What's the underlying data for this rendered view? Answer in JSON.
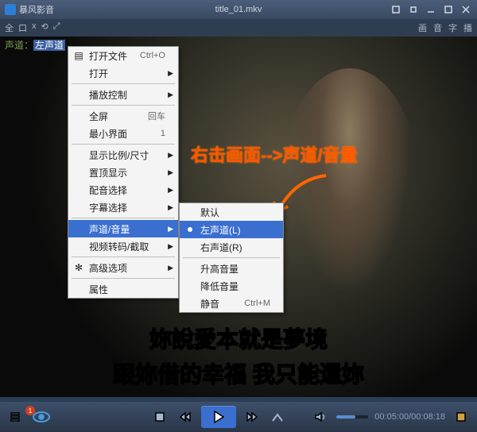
{
  "titlebar": {
    "app_name": "暴风影音",
    "file_title": "title_01.mkv"
  },
  "toolbar": {
    "left": [
      "全",
      "口",
      "x",
      "⟲",
      "⤢"
    ],
    "right": [
      "画",
      "音",
      "字",
      "播"
    ]
  },
  "channel_overlay": {
    "prefix": "声道：",
    "value": "左声道"
  },
  "annotation": "右击画面-->声道/音量",
  "context_menu": {
    "items": [
      {
        "label": "打开文件",
        "shortcut": "Ctrl+O",
        "icon": "open"
      },
      {
        "label": "打开",
        "shortcut": "",
        "sub": true
      },
      {
        "sep": true
      },
      {
        "label": "播放控制",
        "shortcut": "",
        "sub": true
      },
      {
        "sep": true
      },
      {
        "label": "全屏",
        "shortcut": "回车"
      },
      {
        "label": "最小界面",
        "shortcut": "1"
      },
      {
        "sep": true
      },
      {
        "label": "显示比例/尺寸",
        "shortcut": "",
        "sub": true
      },
      {
        "label": "置顶显示",
        "shortcut": "",
        "sub": true
      },
      {
        "label": "配音选择",
        "shortcut": "",
        "sub": true
      },
      {
        "label": "字幕选择",
        "shortcut": "",
        "sub": true
      },
      {
        "sep": true
      },
      {
        "label": "声道/音量",
        "shortcut": "",
        "sub": true,
        "selected": true
      },
      {
        "label": "视频转码/截取",
        "shortcut": "",
        "sub": true
      },
      {
        "sep": true
      },
      {
        "label": "高级选项",
        "shortcut": "",
        "sub": true,
        "icon": "gear"
      },
      {
        "sep": true
      },
      {
        "label": "属性",
        "shortcut": ""
      }
    ]
  },
  "submenu": {
    "items": [
      {
        "label": "默认"
      },
      {
        "label": "左声道(L)",
        "selected": true
      },
      {
        "label": "右声道(R)"
      },
      {
        "sep": true
      },
      {
        "label": "升高音量"
      },
      {
        "label": "降低音量"
      },
      {
        "label": "静音",
        "shortcut": "Ctrl+M"
      }
    ]
  },
  "subtitles": {
    "line1_pink": "妳",
    "line1_rest": "說愛本就是夢境",
    "line2": "跟妳借的幸福 我只能還妳"
  },
  "playback": {
    "current": "00:05:00",
    "total": "00:08:18",
    "badge": "1"
  }
}
